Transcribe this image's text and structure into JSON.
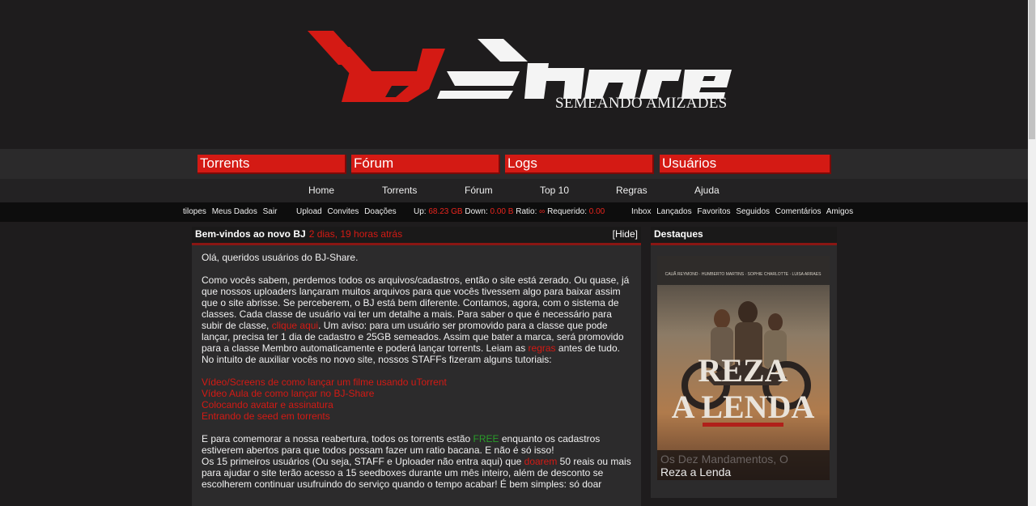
{
  "brand": {
    "logo_text": "bjshare",
    "tagline": "SEMEANDO AMIZADES"
  },
  "tabs": [
    "Torrents",
    "Fórum",
    "Logs",
    "Usuários"
  ],
  "subnav": [
    "Home",
    "Torrents",
    "Fórum",
    "Top 10",
    "Regras",
    "Ajuda"
  ],
  "userbar": {
    "username": "tilopes",
    "links_left": [
      "Meus Dados",
      "Sair"
    ],
    "links_mid": [
      "Upload",
      "Convites",
      "Doações"
    ],
    "up_label": "Up:",
    "up_value": "68.23 GB",
    "down_label": "Down:",
    "down_value": "0.00 B",
    "ratio_label": "Ratio:",
    "ratio_value": "∞",
    "required_label": "Requerido:",
    "required_value": "0.00",
    "links_right": [
      "Inbox",
      "Lançados",
      "Favoritos",
      "Seguidos",
      "Comentários",
      "Amigos"
    ]
  },
  "news": {
    "title": "Bem-vindos ao novo BJ",
    "date": "2 dias, 19 horas atrás",
    "hide_label": "[Hide]",
    "greeting": "Olá, queridos usuários do BJ-Share.",
    "p1_a": "Como vocês sabem, perdemos todos os arquivos/cadastros, então o site está zerado. Ou quase, já que nossos uploaders lançaram muitos arquivos para que vocês tivessem algo para baixar assim que o site abrisse. Se perceberem, o BJ está bem diferente. Contamos, agora, com o sistema de classes. Cada classe de usuário vai ter um detalhe a mais. Para saber o que é necessário para subir de classe, ",
    "p1_link1": "clique aqui",
    "p1_b": ". Um aviso: para um usuário ser promovido para a classe que pode lançar, precisa ter 1 dia de cadastro e 25GB semeados. Assim que bater a marca, será promovido para a classe Membro automaticamente e poderá lançar torrents. Leiam as ",
    "p1_link2": "regras",
    "p1_c": " antes de tudo. No intuito de auxiliar vocês no novo site, nossos STAFFs fizeram alguns tutoriais:",
    "tutorials": [
      "Vídeo/Screens de como lançar um filme usando uTorrent",
      "Vídeo Aula de como lançar no BJ-Share",
      "Colocando avatar e assinatura",
      "Entrando de seed em torrents"
    ],
    "p2_a": "E para comemorar a nossa reabertura, todos os torrents estão ",
    "p2_free": "FREE",
    "p2_b": " enquanto os cadastros estiverem abertos para que todos possam fazer um ratio bacana. E não é só isso!",
    "p3_a": "Os 15 primeiros usuários (Ou seja, STAFF e Uploader não entra aqui) que ",
    "p3_link": "doarem",
    "p3_b": " 50 reais ou mais para ajudar o site terão acesso a 15 seedboxes durante um mês inteiro, além de desconto se escolherem continuar usufruindo do serviço quando o tempo acabar! É bem simples: só doar"
  },
  "sidebar": {
    "title": "Destaques",
    "poster_title_text": "REZA A LENDA",
    "poster_credits": [
      "CAUÃ REYMOND",
      "HUMBERTO MARTINS",
      "SOPHIE CHARLOTTE",
      "LUISA ARRAES"
    ],
    "caption_prev": "Os Dez Mandamentos, O",
    "caption_current": "Reza a Lenda"
  },
  "colors": {
    "accent": "#d41a14",
    "background": "#1e1c1d",
    "panel": "#2c2b2c",
    "free": "#2a9d2a"
  }
}
